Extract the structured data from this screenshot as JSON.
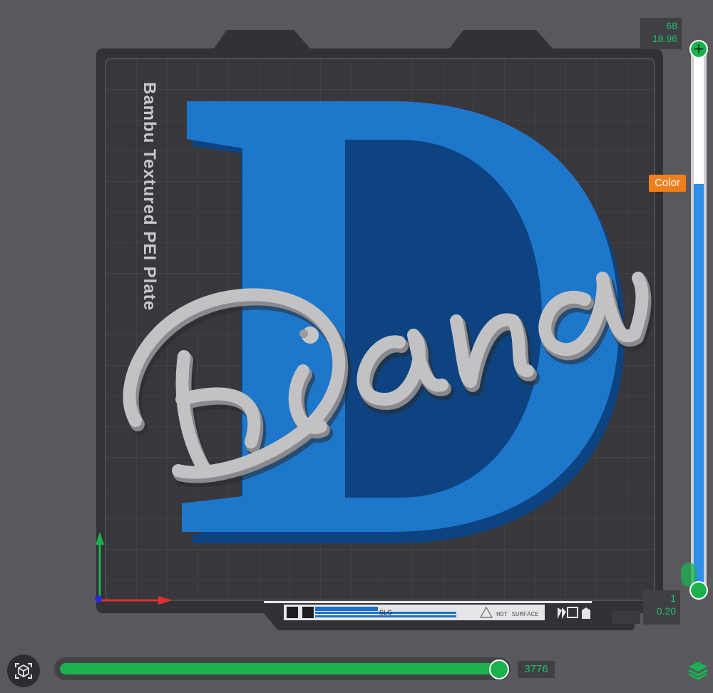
{
  "plate": {
    "name": "Bambu Textured PEI Plate",
    "front_label_text": "HOT SURFACE",
    "front_label_code": "SLG"
  },
  "model": {
    "big_letter": "D",
    "script_text": "Diana",
    "letter_color": "#1a73c6",
    "script_color": "#c9c9cb"
  },
  "layer_slider": {
    "top_layer": "68",
    "top_height": "18.96",
    "bottom_layer": "1",
    "bottom_height": "0.20",
    "color_badge": "Color",
    "accent_color": "#1ab14f",
    "color_band": "#2e8ee9"
  },
  "move_slider": {
    "value": "3776",
    "position_fraction": 1.0
  },
  "icons": {
    "view_toggle": "cube-view-icon",
    "layers": "layers-icon"
  }
}
